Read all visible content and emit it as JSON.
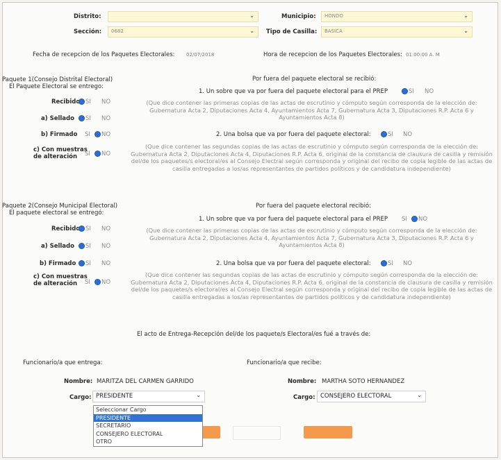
{
  "header": {
    "distrito_label": "Distrito:",
    "municipio_label": "Municipio:",
    "municipio_value": "HONDO",
    "seccion_label": "Sección:",
    "seccion_value": "0682",
    "tipo_casilla_label": "Tipo de Casilla:",
    "tipo_casilla_value": "BASICA",
    "fecha_label": "Fecha de recepcion de los Paquetes Electorales:",
    "fecha_value": "02/07/2018",
    "hora_label": "Hora de recepcion de los Paquetes Electorales:",
    "hora_value": "01:00:00 A. M"
  },
  "paquete1": {
    "title_line1": "Paquete 1(Consejo Distrital Electoral)",
    "title_line2": "El Paquete Electoral se entrego:",
    "recibido": "Recibido",
    "sellado": "a) Sellado",
    "firmado": "b) Firmado",
    "con_muestras_1": "c) Con muestras",
    "con_muestras_2": "de alteración",
    "si": "SI",
    "no": "NO",
    "fuera_title": "Por fuera del paquete electoral se recibió:",
    "q1": "1. Un sobre que va por fuera del paquete electoral para el PREP",
    "q1_desc": "(Que dice contener las primeras copias de las actas de escrutinio y cómputo según corresponda de la elección de: Gubernatura Acta 2, Diputaciones Acta 4, Ayuntamientos Acta 7, Gubernatura Acta 3, Diputaciones R.P. Acta 6 y Ayuntamientos Acta 8)",
    "q2": "2. Una bolsa que va por fuera del paquete electoral:",
    "q2_desc": "(Que dice contener las segundas copias de las actas de escrutinio y cómputo según corresponda de la elección de: Gubernatura Acta 2, Diputaciones Acta 4, Diputaciones R.P. Acta 6, original de la constancia de clausura de casilla y remisión del/de los paquetes/s electoral/es al Consejo Electral según corresponda y original del recibo de copia legible de las actas de casilla entregadas a los/as representantes de partidos políticos y de candidatura independiente)"
  },
  "paquete2": {
    "title_line1": "Paquete 2(Consejo Municipal Electoral)",
    "title_line2": "El paquete electoral se entregó:",
    "recibido": "Recibido",
    "sellado": "a) Sellado",
    "firmado": "b) Firmado",
    "con_muestras_1": "c) Con muestras",
    "con_muestras_2": "de alteración",
    "si": "SI",
    "no": "NO",
    "fuera_title": "Por fuera del paquete electoral recibió:",
    "q1": "1. Un sobre que va por fuera del paquete electoral para el PREP",
    "q1_desc": "(Que dice contener las primeras copias de las actas de escrutinio y cómputo según corresponda de la elección de: Gubernatura Acta 2, Diputaciones Acta 4, Ayuntamientos Acta 7, Gubernatura Acta 3, Diputaciones R.P. Acta 6 y Ayuntamientos Acta 8)",
    "q2": "2. Una bolsa que va por fuera del paquete electoral:",
    "q2_desc": "(Que dice contener las segundas copias de las actas de escrutinio y cómputo según corresponda de la elección de: Gubernatura Acta 2, Diputaciones Acta 4, Diputaciones R.P. Acta 6, original de la constancia de clausura de casilla y remisión del/de los paquetes/s electoral/es al Consejo Electral según corresponda y original del recibo de copia legible de las actas de casilla entregadas a los/as representantes de partidos políticos y de candidatura independiente)"
  },
  "entrega": {
    "acto_title": "El acto de Entrega-Recepción del/de los paquete/s Electoral/es fué a través de:",
    "funcionario_entrega": "Funcionario/a que entrega:",
    "funcionario_recibe": "Funcionario/a que recibe:",
    "nombre_label": "Nombre:",
    "nombre_entrega": "MARITZA DEL CARMEN GARRIDO",
    "nombre_recibe": "MARTHA SOTO HERNANDEZ",
    "cargo_label": "Cargo:",
    "cargo_entrega": "PRESIDENTE",
    "cargo_recibe": "CONSEJERO ELECTORAL",
    "options": [
      "Seleccionar Cargo",
      "PRESIDENTE",
      "SECRETARIO",
      "CONSEJERO ELECTORAL",
      "OTRO"
    ],
    "selected_option": "PRESIDENTE"
  },
  "colors": {
    "accent": "#f39a4c",
    "highlight": "#3073d6",
    "field_bg": "#fcf8d6",
    "radio": "#2b6fd6"
  }
}
